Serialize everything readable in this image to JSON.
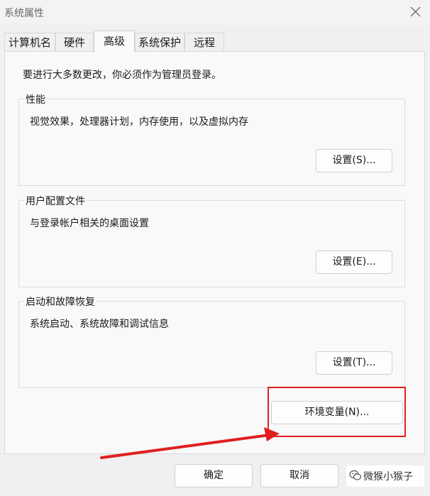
{
  "window": {
    "title": "系统属性",
    "close_icon": "close-icon"
  },
  "tabs": [
    {
      "label": "计算机名",
      "active": false
    },
    {
      "label": "硬件",
      "active": false
    },
    {
      "label": "高级",
      "active": true
    },
    {
      "label": "系统保护",
      "active": false
    },
    {
      "label": "远程",
      "active": false
    }
  ],
  "admin_note": "要进行大多数更改，你必须作为管理员登录。",
  "groups": [
    {
      "title": "性能",
      "description": "视觉效果，处理器计划，内存使用，以及虚拟内存",
      "button": "设置(S)..."
    },
    {
      "title": "用户配置文件",
      "description": "与登录帐户相关的桌面设置",
      "button": "设置(E)..."
    },
    {
      "title": "启动和故障恢复",
      "description": "系统启动、系统故障和调试信息",
      "button": "设置(T)..."
    }
  ],
  "env_button": "环境变量(N)...",
  "footer": {
    "ok": "确定",
    "cancel": "取消"
  },
  "watermark": {
    "text": "微猴小猴子",
    "icon": "wechat-icon"
  },
  "colors": {
    "highlight": "#e02020",
    "panel": "#f9f9f9",
    "background": "#f0f0f0"
  }
}
